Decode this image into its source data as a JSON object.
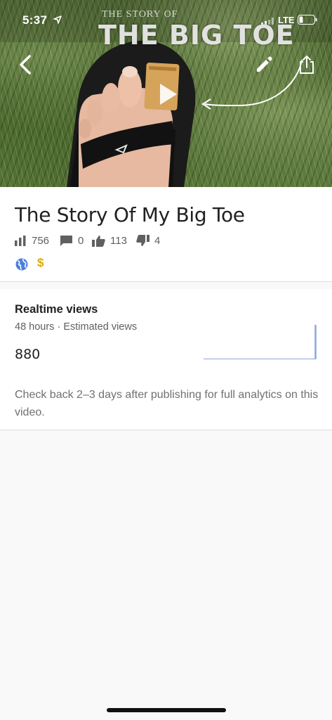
{
  "status_bar": {
    "time": "5:37",
    "network": "LTE"
  },
  "video": {
    "thumbnail_title_small": "THE STORY OF",
    "thumbnail_title_big": "THE BIG TOE"
  },
  "info": {
    "title": "The Story Of My Big Toe",
    "views": "756",
    "comments": "0",
    "likes": "113",
    "dislikes": "4",
    "visibility_icon": "globe-icon",
    "monetization_symbol": "$"
  },
  "realtime": {
    "title": "Realtime views",
    "subtitle": "48 hours · Estimated views",
    "value": "880",
    "note": "Check back 2–3 days after publishing for full analytics on this video."
  },
  "colors": {
    "accent_blue": "#4a7fdc",
    "monetization_yellow": "#e0a800",
    "sparkline": "#8aa6e0"
  }
}
